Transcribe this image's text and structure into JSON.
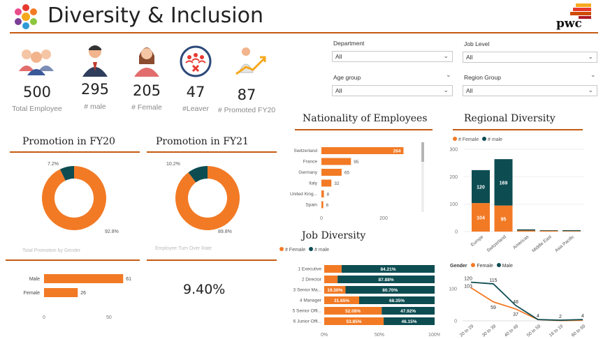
{
  "header": {
    "title": "Diversity & Inclusion",
    "brand": "pwc"
  },
  "kpis": [
    {
      "value": "500",
      "label": "Total Employee",
      "icon": "group-icon"
    },
    {
      "value": "295",
      "label": "# male",
      "icon": "male-person-icon"
    },
    {
      "value": "205",
      "label": "# Female",
      "icon": "female-person-icon"
    },
    {
      "value": "47",
      "label": "#Leaver",
      "icon": "leaver-icon"
    },
    {
      "value": "87",
      "label": "# Promoted FY20",
      "icon": "promotion-icon"
    }
  ],
  "filters": {
    "department": {
      "label": "Department",
      "value": "All"
    },
    "job_level": {
      "label": "Job Level",
      "value": "All"
    },
    "age_group": {
      "label": "Age group",
      "value": "All"
    },
    "region_group": {
      "label": "Region Group",
      "value": "All"
    }
  },
  "colors": {
    "orange": "#f27a25",
    "teal": "#0d4d52",
    "accent": "#c55a11"
  },
  "promotion_fy20": {
    "title": "Promotion in FY20",
    "small_label": "7.2%",
    "large_label": "92.8%"
  },
  "promotion_fy21": {
    "title": "Promotion in FY21",
    "small_label": "10.2%",
    "large_label": "89.8%"
  },
  "promotion_by_gender": {
    "subtitle": "Total Promotion by Gender"
  },
  "turnover": {
    "subtitle": "Employee Turn Over Rate",
    "value": "9.40%"
  },
  "nationality": {
    "title": "Nationality of Employees"
  },
  "regional": {
    "title": "Regional Diversity",
    "legend_female": "# Female",
    "legend_male": "# male"
  },
  "job_diversity": {
    "title": "Job Diversity",
    "legend_female": "# Female",
    "legend_male": "# male"
  },
  "gender_age": {
    "legend_title": "Gender",
    "legend_female": "Female",
    "legend_male": "Male"
  },
  "chart_data": [
    {
      "type": "pie",
      "title": "Promotion in FY20",
      "values": [
        92.8,
        7.2
      ],
      "labels": [
        "92.8%",
        "7.2%"
      ],
      "colors": [
        "#f27a25",
        "#0d4d52"
      ]
    },
    {
      "type": "pie",
      "title": "Promotion in FY21",
      "values": [
        89.8,
        10.2
      ],
      "labels": [
        "89.8%",
        "10.2%"
      ],
      "colors": [
        "#f27a25",
        "#0d4d52"
      ]
    },
    {
      "type": "bar",
      "orientation": "horizontal",
      "title": "Total Promotion by Gender",
      "categories": [
        "Male",
        "Female"
      ],
      "values": [
        61,
        26
      ],
      "xlim": [
        0,
        70
      ],
      "xticks": [
        "0",
        "50"
      ]
    },
    {
      "type": "bar",
      "orientation": "horizontal",
      "title": "Nationality of Employees",
      "categories": [
        "Switzerland",
        "France",
        "Germany",
        "Italy",
        "United King...",
        "Spain"
      ],
      "values": [
        264,
        95,
        65,
        32,
        8,
        6
      ],
      "xlim": [
        0,
        300
      ],
      "xticks": [
        "0",
        "200"
      ]
    },
    {
      "type": "bar",
      "stacked": true,
      "title": "Regional Diversity",
      "categories": [
        "Europe",
        "Switzerland",
        "Americas",
        "Middle East",
        "Asia Pacific"
      ],
      "series": [
        {
          "name": "# Female",
          "values": [
            104,
            95,
            4,
            3,
            2
          ]
        },
        {
          "name": "# male",
          "values": [
            120,
            169,
            4,
            2,
            3
          ]
        }
      ],
      "ylim": [
        0,
        300
      ],
      "yticks": [
        "0",
        "100",
        "200",
        "300"
      ],
      "labels_female": [
        "104",
        "95",
        "",
        "",
        ""
      ],
      "labels_male": [
        "120",
        "169",
        "",
        "",
        ""
      ]
    },
    {
      "type": "bar",
      "stacked": true,
      "orientation": "horizontal",
      "percent": true,
      "title": "Job Diversity",
      "categories": [
        "1   Executive",
        "2   Director",
        "3   Senior Ma...",
        "4   Manager",
        "5   Senior Offi...",
        "6   Junior Offi..."
      ],
      "series": [
        {
          "name": "# Female",
          "values": [
            15.79,
            12.12,
            19.3,
            31.65,
            52.08,
            53.85
          ],
          "labels": [
            "",
            "",
            "19.30%",
            "31.65%",
            "52.08%",
            "53.85%"
          ]
        },
        {
          "name": "# male",
          "values": [
            84.21,
            87.88,
            80.7,
            68.35,
            47.92,
            46.15
          ],
          "labels": [
            "84.21%",
            "87.88%",
            "80.70%",
            "68.35%",
            "47.92%",
            "46.15%"
          ]
        }
      ],
      "xticks": [
        "0%",
        "50%",
        "100%"
      ]
    },
    {
      "type": "line",
      "title": "Gender",
      "categories": [
        "20 to 29",
        "30 to 39",
        "40 to 49",
        "50 to 59",
        "16 to 19",
        "60 to 69"
      ],
      "series": [
        {
          "name": "Female",
          "values": [
            103,
            59,
            37,
            4,
            1,
            2
          ]
        },
        {
          "name": "Male",
          "values": [
            120,
            115,
            48,
            4,
            2,
            4
          ]
        }
      ],
      "ylim": [
        0,
        130
      ],
      "yticks": [
        "0",
        "100"
      ],
      "labels_male": [
        "120",
        "115",
        "48",
        "4",
        "2",
        "4"
      ],
      "labels_female": [
        "103",
        "59",
        "37",
        "",
        "",
        ""
      ]
    }
  ]
}
